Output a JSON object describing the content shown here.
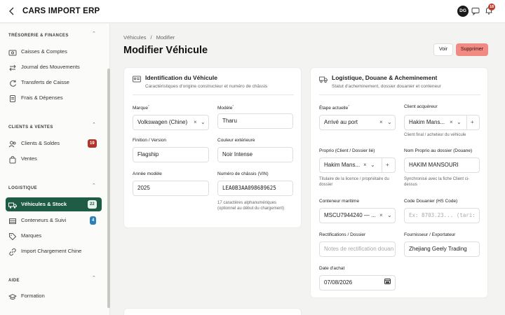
{
  "app": {
    "title": "CARS IMPORT ERP",
    "avatar_initials": "DG",
    "notif_count": "18",
    "accent": "#1f5c45",
    "danger": "#c0392b"
  },
  "sidebar": {
    "sections": [
      {
        "title": "TRÉSORERIE & FINANCES",
        "items": [
          {
            "label": "Caisses & Comptes",
            "icon": "cash-register-icon"
          },
          {
            "label": "Journal des Mouvements",
            "icon": "arrows-exchange-icon"
          },
          {
            "label": "Transferts de Caisse",
            "icon": "refresh-icon"
          },
          {
            "label": "Frais & Dépenses",
            "icon": "receipt-icon"
          }
        ]
      },
      {
        "title": "CLIENTS & VENTES",
        "items": [
          {
            "label": "Clients & Soldes",
            "icon": "users-icon",
            "badge": "19"
          },
          {
            "label": "Ventes",
            "icon": "shopping-bag-icon"
          }
        ]
      },
      {
        "title": "LOGISTIQUE",
        "items": [
          {
            "label": "Véhicules & Stock",
            "icon": "truck-icon",
            "badge": "22",
            "active": true
          },
          {
            "label": "Conteneurs & Suivi",
            "icon": "container-icon",
            "badge": "4"
          },
          {
            "label": "Marques",
            "icon": "tag-icon"
          },
          {
            "label": "Import Chargement Chine",
            "icon": "link-icon"
          }
        ]
      },
      {
        "title": "AIDE",
        "items": [
          {
            "label": "Formation",
            "icon": "graduation-cap-icon"
          }
        ]
      }
    ]
  },
  "breadcrumb": [
    "Véhicules",
    "/",
    "Modifier"
  ],
  "page": {
    "title": "Modifier Véhicule",
    "voir_label": "Voir",
    "supprimer_label": "Supprimer"
  },
  "ident": {
    "title": "Identification du Véhicule",
    "subtitle": "Caractéristiques d'origine constructeur et numéro de châssis",
    "marque_label": "Marque",
    "marque_value": "Volkswagen (Chine)",
    "modele_label": "Modèle",
    "modele_value": "Tharu",
    "finition_label": "Finition / Version",
    "finition_value": "Flagship",
    "couleur_label": "Couleur extérieure",
    "couleur_value": "Noir Intense",
    "annee_label": "Année modèle",
    "annee_value": "2025",
    "vin_label": "Numéro de châssis (VIN)",
    "vin_value": "LEA0B3AA098689625",
    "vin_help": "17 caractères alphanumériques (optionnel au début du chargement)"
  },
  "logistique": {
    "title": "Logistique, Douane & Acheminement",
    "subtitle": "Statut d'acheminement, dossier douanier et conteneur",
    "etape_label": "Étape actuelle",
    "etape_value": "Arrivé au port",
    "client_label": "Client acquéreur",
    "client_value": "Hakim Mans...",
    "client_help": "Client final / acheteur du véhicule",
    "proprio_label": "Proprio (Client / Dossier lié)",
    "proprio_value": "Hakim Mans...",
    "proprio_help": "Titulaire de la licence / propriétaire du dossier",
    "nom_proprio_label": "Nom Proprio au dossier (Douane)",
    "nom_proprio_value": "HAKIM MANSOURI",
    "nom_proprio_help": "Synchronisé avec la fiche Client ci-dessus",
    "conteneur_label": "Conteneur maritime",
    "conteneur_value": "MSCU7944240 — ...",
    "hs_label": "Code Douanier (HS Code)",
    "hs_placeholder": "Ex: 8703.23... (tari:",
    "rectif_label": "Rectifications / Dossier",
    "rectif_placeholder": "Notes de rectification douan",
    "fournisseur_label": "Fournisseur / Exportateur",
    "fournisseur_value": "Zhejiang Geely Trading",
    "date_label": "Date d'achat",
    "date_value": "07/08/2026"
  }
}
